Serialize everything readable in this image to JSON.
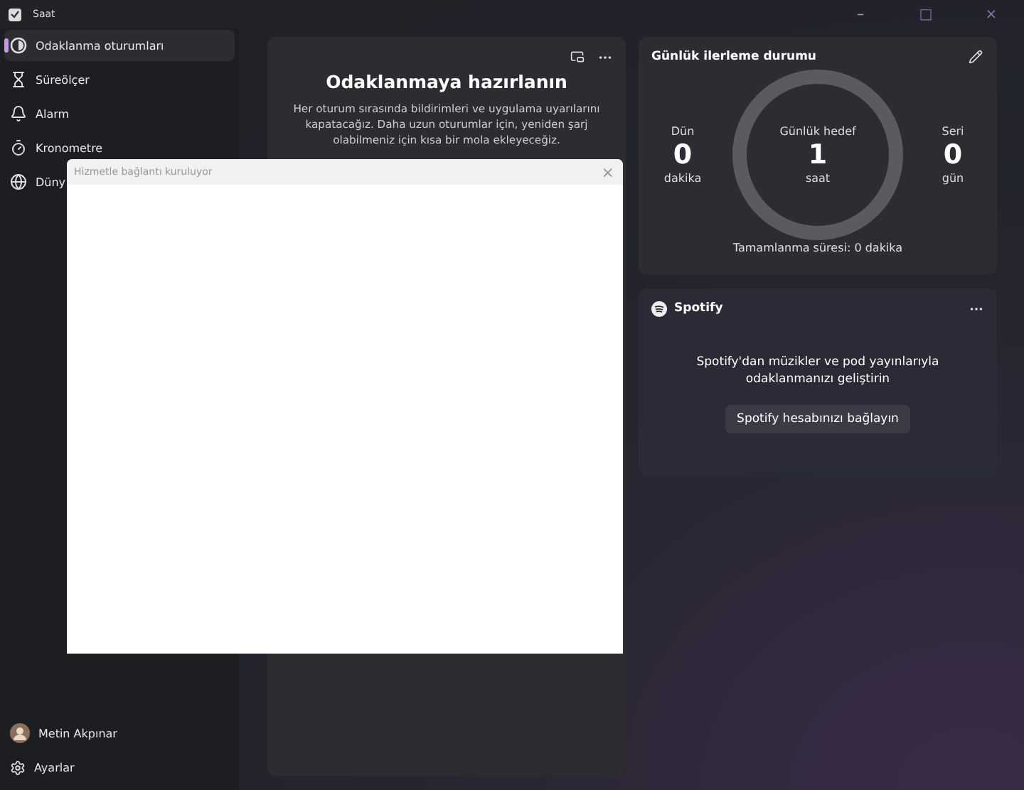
{
  "window": {
    "title": "Saat",
    "controls": [
      "–",
      "□",
      "×"
    ]
  },
  "sidebar": {
    "items": [
      {
        "label": "Odaklanma oturumları",
        "selected": true
      },
      {
        "label": "Süreölçer",
        "selected": false
      },
      {
        "label": "Alarm",
        "selected": false
      },
      {
        "label": "Kronometre",
        "selected": false
      },
      {
        "label": "Düny",
        "selected": false
      }
    ],
    "user": {
      "name": "Metin Akpınar"
    },
    "settings": {
      "label": "Ayarlar"
    }
  },
  "focus_card": {
    "title": "Odaklanmaya hazırlanın",
    "body": "Her oturum sırasında bildirimleri ve uygulama uyarılarını kapatacağız. Daha uzun oturumlar için, yeniden şarj olabilmeniz için kısa bir mola ekleyeceğiz."
  },
  "progress_card": {
    "title": "Günlük ilerleme durumu",
    "stats": [
      {
        "label": "Dün",
        "value": "0",
        "unit": "dakika"
      },
      {
        "label": "Günlük hedef",
        "value": "1",
        "unit": "saat"
      },
      {
        "label": "Seri",
        "value": "0",
        "unit": "gün"
      }
    ],
    "footer": "Tamamlanma süresi: 0 dakika"
  },
  "spotify_card": {
    "title": "Spotify",
    "text": "Spotify'dan müzikler ve pod yayınlarıyla odaklanmanızı geliştirin",
    "button": "Spotify hesabınızı bağlayın"
  },
  "dialog": {
    "title": "Hizmetle bağlantı kuruluyor",
    "close": "×"
  }
}
